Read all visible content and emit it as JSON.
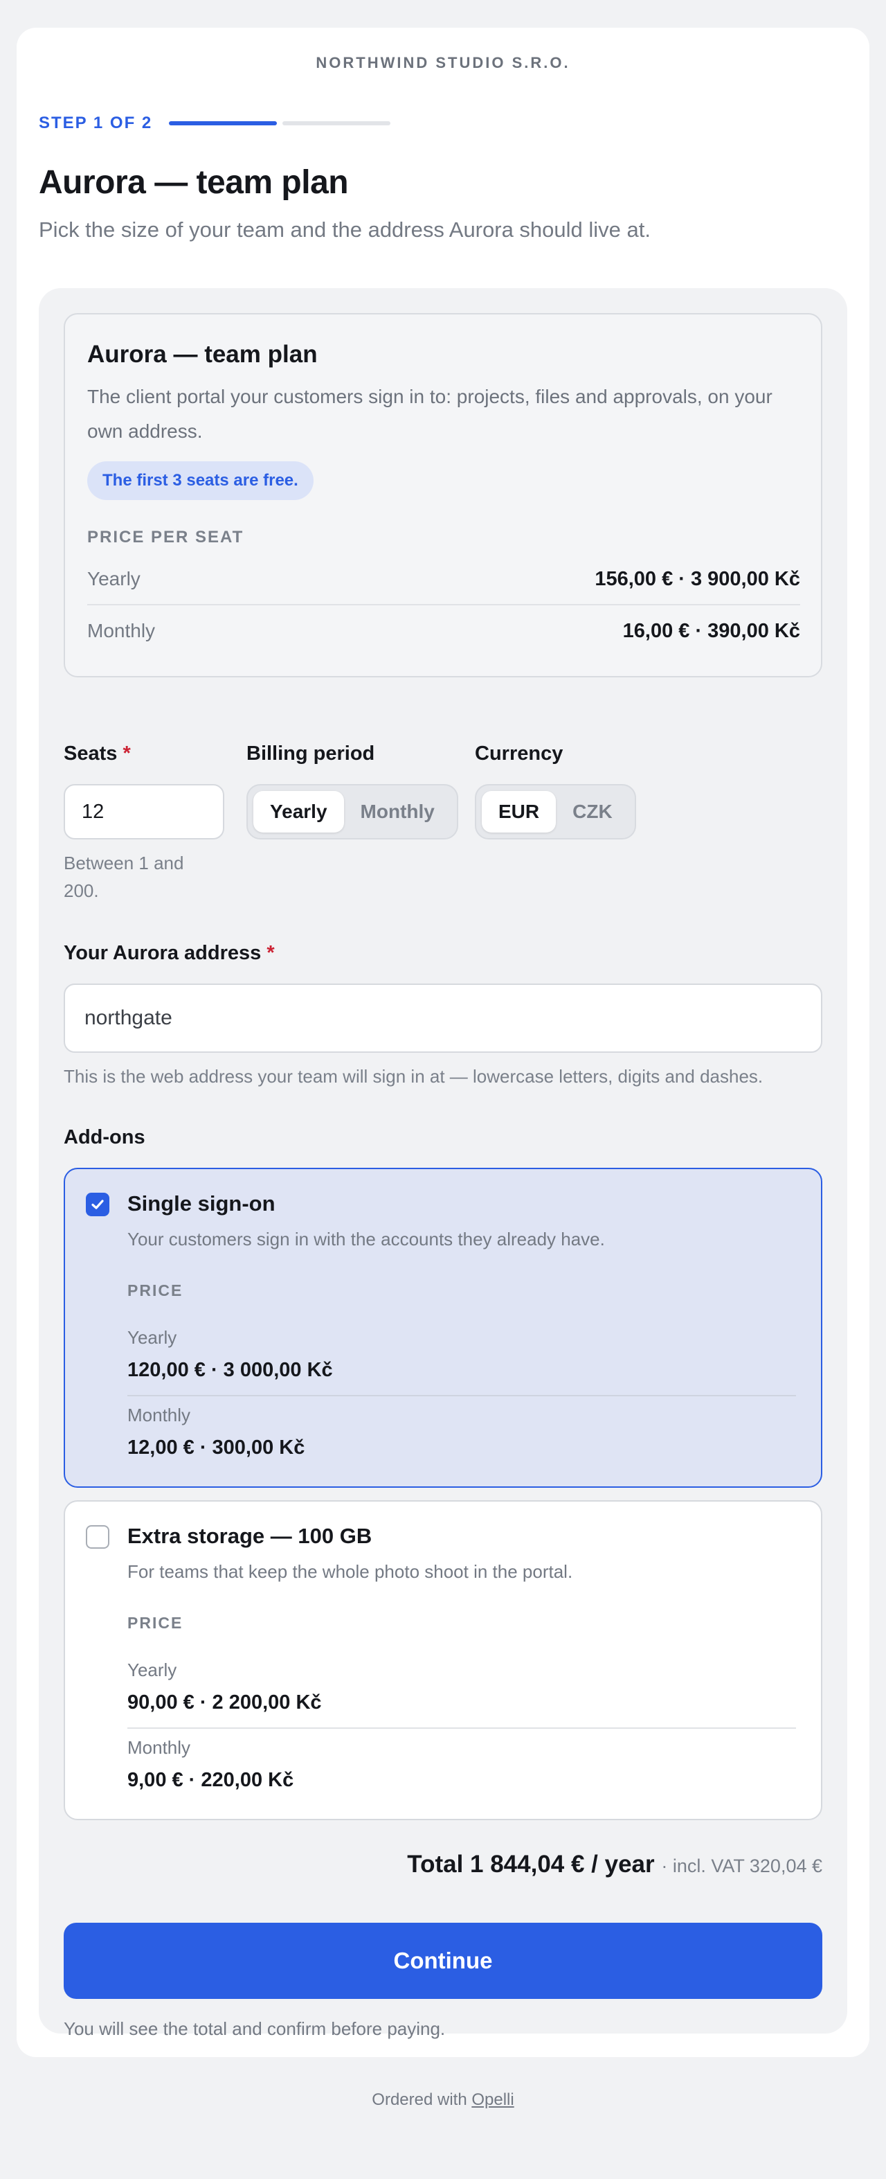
{
  "merchant": "NORTHWIND STUDIO S.R.O.",
  "stepper": {
    "label": "STEP 1 OF 2",
    "current": 1,
    "total": 2
  },
  "header": {
    "title": "Aurora — team plan",
    "subtitle": "Pick the size of your team and the address Aurora should live at."
  },
  "plan": {
    "title": "Aurora — team plan",
    "description": "The client portal your customers sign in to: projects, files and approvals, on your own address.",
    "badge": "The first 3 seats are free.",
    "price_label": "PRICE PER SEAT",
    "prices": [
      {
        "period": "Yearly",
        "value": "156,00 € · 3 900,00 Kč"
      },
      {
        "period": "Monthly",
        "value": "16,00 € · 390,00 Kč"
      }
    ]
  },
  "seats": {
    "label": "Seats",
    "required_mark": "*",
    "value": "12",
    "hint": "Between 1 and 200."
  },
  "billing": {
    "label": "Billing period",
    "options": [
      "Yearly",
      "Monthly"
    ],
    "selected": "Yearly"
  },
  "currency": {
    "label": "Currency",
    "options": [
      "EUR",
      "CZK"
    ],
    "selected": "EUR"
  },
  "address": {
    "label": "Your Aurora address",
    "required_mark": "*",
    "value": "northgate",
    "hint": "This is the web address your team will sign in at — lowercase letters, digits and dashes."
  },
  "addons": {
    "label": "Add-ons",
    "items": [
      {
        "title": "Single sign-on",
        "description": "Your customers sign in with the accounts they already have.",
        "checked": true,
        "price_label": "PRICE",
        "prices": [
          {
            "period": "Yearly",
            "value": "120,00 € · 3 000,00 Kč"
          },
          {
            "period": "Monthly",
            "value": "12,00 € · 300,00 Kč"
          }
        ]
      },
      {
        "title": "Extra storage — 100 GB",
        "description": "For teams that keep the whole photo shoot in the portal.",
        "checked": false,
        "price_label": "PRICE",
        "prices": [
          {
            "period": "Yearly",
            "value": "90,00 € · 2 200,00 Kč"
          },
          {
            "period": "Monthly",
            "value": "9,00 € · 220,00 Kč"
          }
        ]
      }
    ]
  },
  "total": {
    "text": "Total 1 844,04 € / year",
    "vat": "· incl. VAT 320,04 €"
  },
  "continue_label": "Continue",
  "confirm_note": "You will see the total and confirm before paying.",
  "footer": {
    "prefix": "Ordered with",
    "link": "Opelli"
  },
  "colors": {
    "accent": "#2b5ee3",
    "background": "#f1f2f4",
    "required": "#cc2233"
  }
}
